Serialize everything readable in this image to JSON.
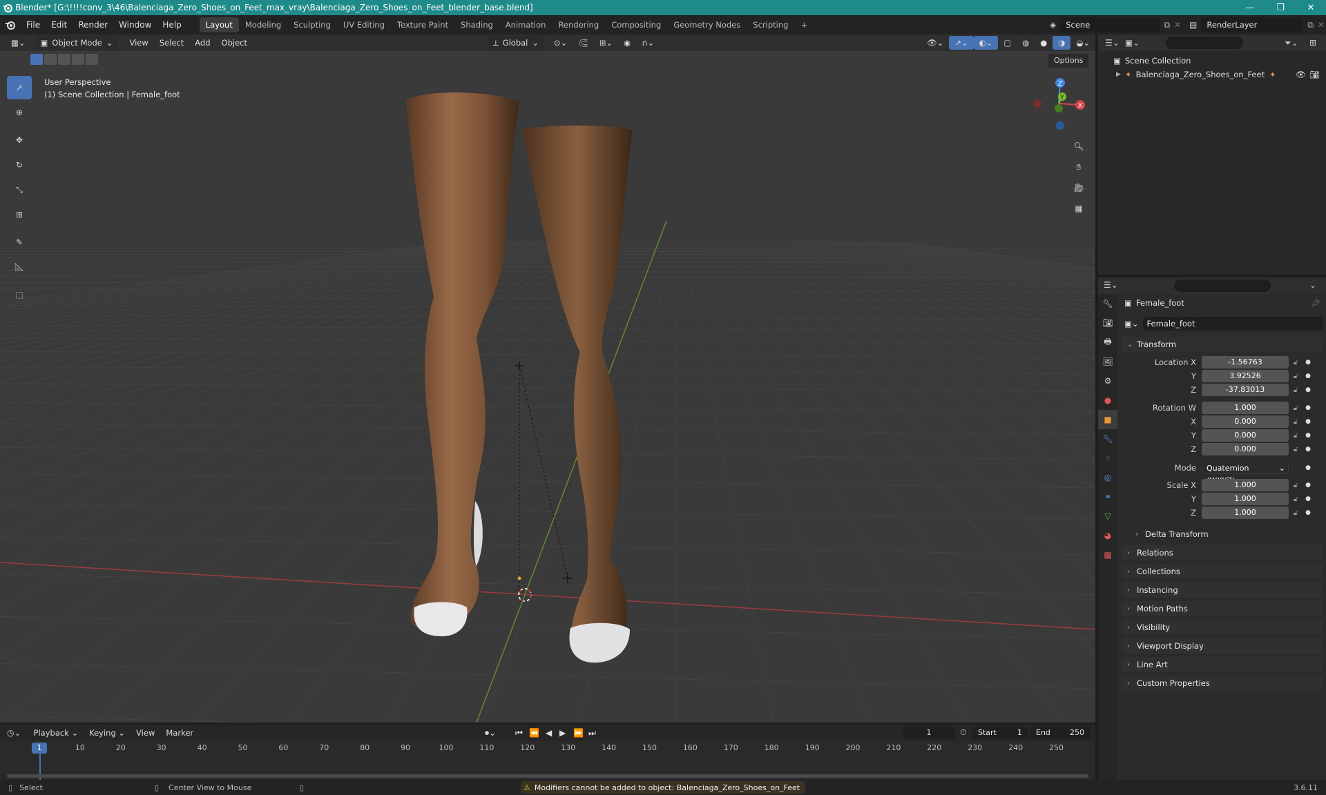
{
  "window": {
    "title": "Blender* [G:\\!!!!conv_3\\46\\Balenciaga_Zero_Shoes_on_Feet_max_vray\\Balenciaga_Zero_Shoes_on_Feet_blender_base.blend]",
    "minimize": "—",
    "maximize": "❐",
    "close": "✕"
  },
  "menu": {
    "items": [
      "File",
      "Edit",
      "Render",
      "Window",
      "Help"
    ]
  },
  "workspaces": {
    "tabs": [
      "Layout",
      "Modeling",
      "Sculpting",
      "UV Editing",
      "Texture Paint",
      "Shading",
      "Animation",
      "Rendering",
      "Compositing",
      "Geometry Nodes",
      "Scripting"
    ],
    "add": "+"
  },
  "scene": {
    "name": "Scene",
    "renderlayer": "RenderLayer"
  },
  "viewport": {
    "mode": "Object Mode",
    "menus": [
      "View",
      "Select",
      "Add",
      "Object"
    ],
    "orientation": "Global",
    "options": "Options",
    "info_line1": "User Perspective",
    "info_line2": "(1) Scene Collection | Female_foot",
    "gizmo": {
      "z": "Z",
      "y": "Y",
      "x": "X"
    }
  },
  "outliner": {
    "root": "Scene Collection",
    "item": "Balenciaga_Zero_Shoes_on_Feet"
  },
  "properties": {
    "object_name": "Female_foot",
    "data_name": "Female_foot",
    "transform_title": "Transform",
    "location": {
      "label": "Location X",
      "x": "-1.56763",
      "y": "3.92526",
      "z": "-37.83013"
    },
    "rotation": {
      "label": "Rotation W",
      "w": "1.000",
      "x": "0.000",
      "y": "0.000",
      "z": "0.000"
    },
    "mode_label": "Mode",
    "mode_value": "Quaternion (WXYZ)",
    "scale": {
      "label": "Scale X",
      "x": "1.000",
      "y": "1.000",
      "z": "1.000"
    },
    "axis_y": "Y",
    "axis_x": "X",
    "axis_z": "Z",
    "sections": [
      "Delta Transform",
      "Relations",
      "Collections",
      "Instancing",
      "Motion Paths",
      "Visibility",
      "Viewport Display",
      "Line Art",
      "Custom Properties"
    ]
  },
  "timeline": {
    "menus": [
      "Playback",
      "Keying",
      "View",
      "Marker"
    ],
    "current_frame": "1",
    "start_label": "Start",
    "start": "1",
    "end_label": "End",
    "end": "250",
    "ticks": [
      "10",
      "20",
      "30",
      "40",
      "50",
      "60",
      "70",
      "80",
      "90",
      "100",
      "110",
      "120",
      "130",
      "140",
      "150",
      "160",
      "170",
      "180",
      "190",
      "200",
      "210",
      "220",
      "230",
      "240",
      "250"
    ],
    "playhead": "1"
  },
  "status": {
    "select": "Select",
    "center_view": "Center View to Mouse",
    "warning": "Modifiers cannot be added to object: Balenciaga_Zero_Shoes_on_Feet",
    "version": "3.6.11"
  },
  "colors": {
    "accent": "#4772b3",
    "titlebar": "#1f8a8a",
    "axis_x": "#d8434e",
    "axis_y": "#7cbc2b",
    "axis_z": "#3f86e0"
  }
}
